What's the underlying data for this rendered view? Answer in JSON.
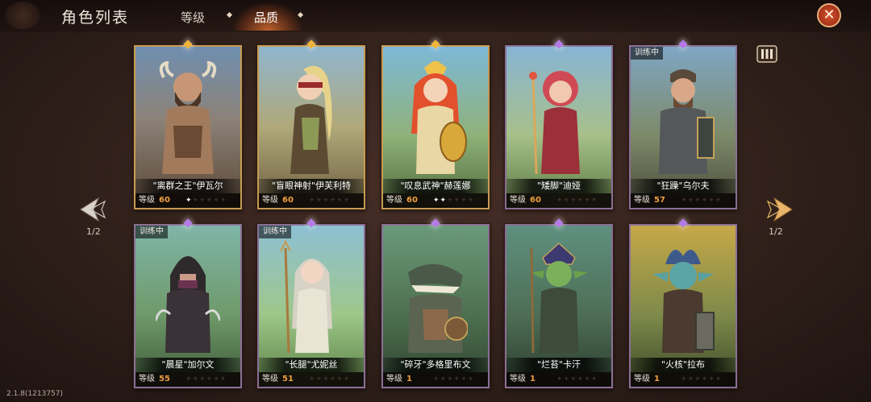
{
  "header": {
    "title": "角色列表",
    "tabs": [
      {
        "label": "等级",
        "active": false
      },
      {
        "label": "品质",
        "active": true
      }
    ],
    "close_icon": "close-x-icon"
  },
  "pagination": {
    "left_label": "1/2",
    "right_label": "1/2"
  },
  "version": "2.1.8(1213757)",
  "filter_icon": "grid-view-icon",
  "level_label": "等级",
  "training_label": "训练中",
  "colors": {
    "gold": "#c79b52",
    "purple": "#8a6f95",
    "level": "#f0a040",
    "accent": "#e9622e"
  },
  "cards": [
    {
      "name": "\"离群之王\"伊瓦尔",
      "level": "60",
      "stars_lit": 1,
      "quality": "gold",
      "training": false
    },
    {
      "name": "\"盲眼神射\"伊芙利特",
      "level": "60",
      "stars_lit": 0,
      "quality": "gold",
      "training": false
    },
    {
      "name": "\"叹息武神\"赫莲娜",
      "level": "60",
      "stars_lit": 2,
      "quality": "gold",
      "training": false
    },
    {
      "name": "\"矮脚\"迪娅",
      "level": "60",
      "stars_lit": 0,
      "quality": "purple",
      "training": false
    },
    {
      "name": "\"狂躁\"乌尔夫",
      "level": "57",
      "stars_lit": 0,
      "quality": "purple",
      "training": true
    },
    {
      "name": "\"晨星\"加尔文",
      "level": "55",
      "stars_lit": 0,
      "quality": "purple",
      "training": true
    },
    {
      "name": "\"长腿\"尤妮丝",
      "level": "51",
      "stars_lit": 0,
      "quality": "purple",
      "training": true
    },
    {
      "name": "\"碎牙\"多格里布文",
      "level": "1",
      "stars_lit": 0,
      "quality": "purple",
      "training": false
    },
    {
      "name": "\"烂苔\"卡汗",
      "level": "1",
      "stars_lit": 0,
      "quality": "purple",
      "training": false
    },
    {
      "name": "\"火核\"拉布",
      "level": "1",
      "stars_lit": 0,
      "quality": "purple",
      "training": false
    }
  ]
}
